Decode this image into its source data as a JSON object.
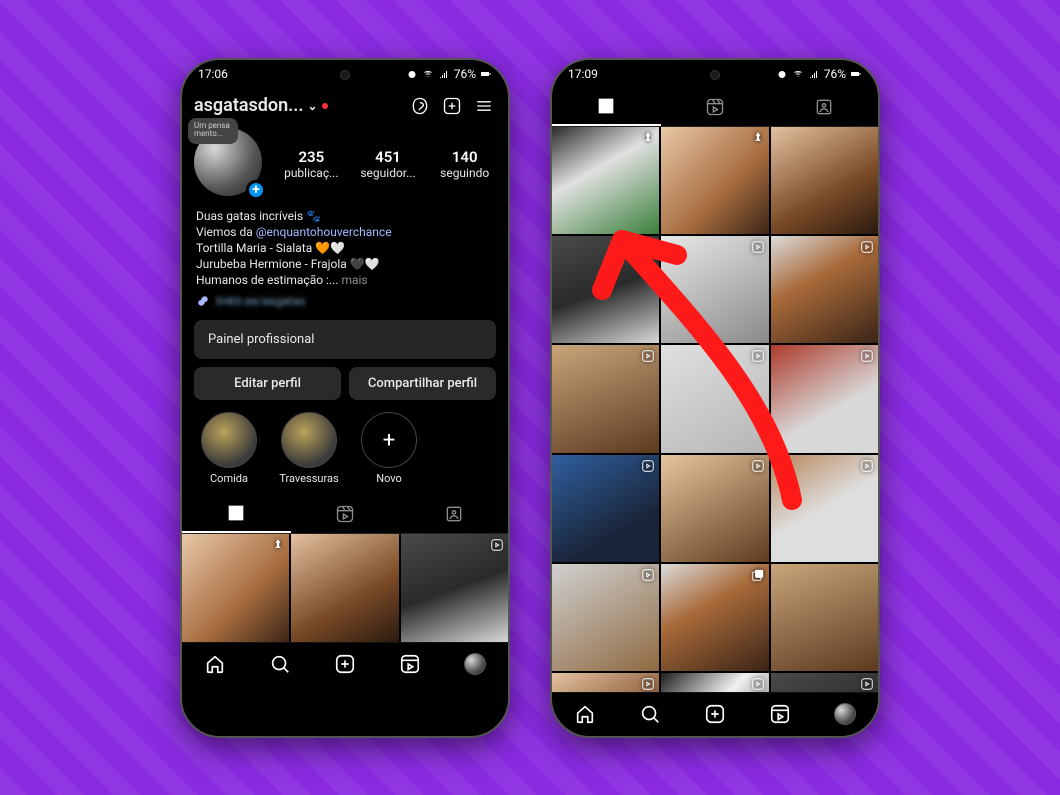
{
  "left": {
    "status": {
      "time": "17:06",
      "battery": "76%"
    },
    "header": {
      "username": "asgatasdon..."
    },
    "stats": {
      "posts": {
        "count": "235",
        "label": "publicaç..."
      },
      "followers": {
        "count": "451",
        "label": "seguidor..."
      },
      "following": {
        "count": "140",
        "label": "seguindo"
      }
    },
    "story_note": "Um pensa mento...",
    "bio": {
      "line1": "Duas gatas incríveis 🐾",
      "line2_pre": "Viemos da ",
      "line2_link": "@enquantohouverchance",
      "line3": "Tortilla Maria - Sialata 🧡🤍",
      "line4": "Jurubeba Hermione - Frajola 🖤🤍",
      "line5_pre": "Humanos de estimação :... ",
      "mais": "mais"
    },
    "link_blur": "linktr.ee/asgatas",
    "panel": "Painel profissional",
    "actions": {
      "edit": "Editar perfil",
      "share": "Compartilhar perfil"
    },
    "highlights": [
      {
        "label": "Comida"
      },
      {
        "label": "Travessuras"
      },
      {
        "label": "Novo"
      }
    ]
  },
  "right": {
    "status": {
      "time": "17:09",
      "battery": "76%"
    }
  }
}
